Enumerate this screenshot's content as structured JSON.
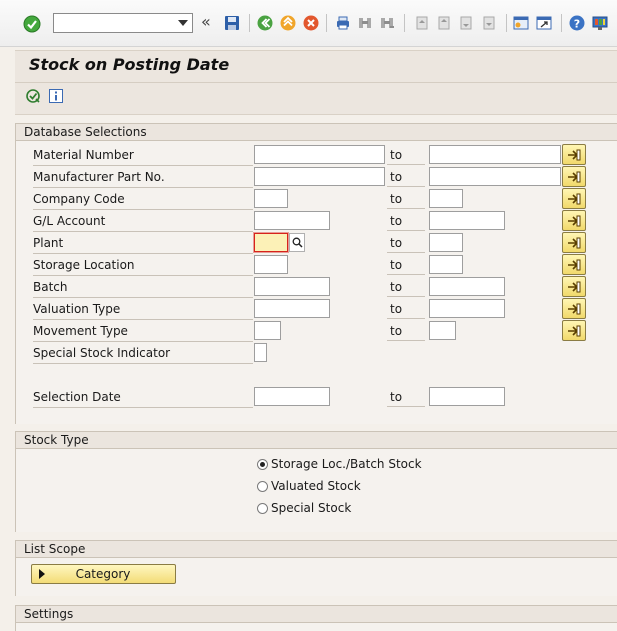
{
  "toolbar": {
    "command_field": {
      "value": "",
      "placeholder": ""
    },
    "icons": [
      "enter-icon",
      "save-icon",
      "back-icon",
      "exit-icon",
      "cancel-icon",
      "print-icon",
      "find-icon",
      "find-next-icon",
      "first-page-icon",
      "previous-page-icon",
      "next-page-icon",
      "last-page-icon",
      "create-session-icon",
      "shortcut-icon",
      "help-icon",
      "customize-layout-icon"
    ]
  },
  "title": "Stock on Posting Date",
  "app_toolbar": {
    "icons": [
      "execute-icon",
      "info-icon"
    ]
  },
  "database_selections": {
    "header": "Database Selections",
    "to_label": "to",
    "rows": [
      {
        "label": "Material Number",
        "from": "",
        "to": ""
      },
      {
        "label": "Manufacturer Part No.",
        "from": "",
        "to": ""
      },
      {
        "label": "Company Code",
        "from": "",
        "to": ""
      },
      {
        "label": "G/L Account",
        "from": "",
        "to": ""
      },
      {
        "label": "Plant",
        "from": "",
        "to": ""
      },
      {
        "label": "Storage Location",
        "from": "",
        "to": ""
      },
      {
        "label": "Batch",
        "from": "",
        "to": ""
      },
      {
        "label": "Valuation Type",
        "from": "",
        "to": ""
      },
      {
        "label": "Movement Type",
        "from": "",
        "to": ""
      },
      {
        "label": "Special Stock Indicator",
        "value": ""
      },
      {
        "label": "Selection Date",
        "from": "",
        "to": ""
      }
    ]
  },
  "stock_type": {
    "header": "Stock Type",
    "options": [
      {
        "label": "Storage Loc./Batch Stock",
        "selected": true
      },
      {
        "label": "Valuated Stock",
        "selected": false
      },
      {
        "label": "Special Stock",
        "selected": false
      }
    ]
  },
  "list_scope": {
    "header": "List Scope",
    "button_label": "Category"
  },
  "settings": {
    "header": "Settings"
  },
  "colors": {
    "button_yellow": "#f3dc77",
    "focus_red": "#d7231b",
    "enter_green": "#3aa23a"
  }
}
